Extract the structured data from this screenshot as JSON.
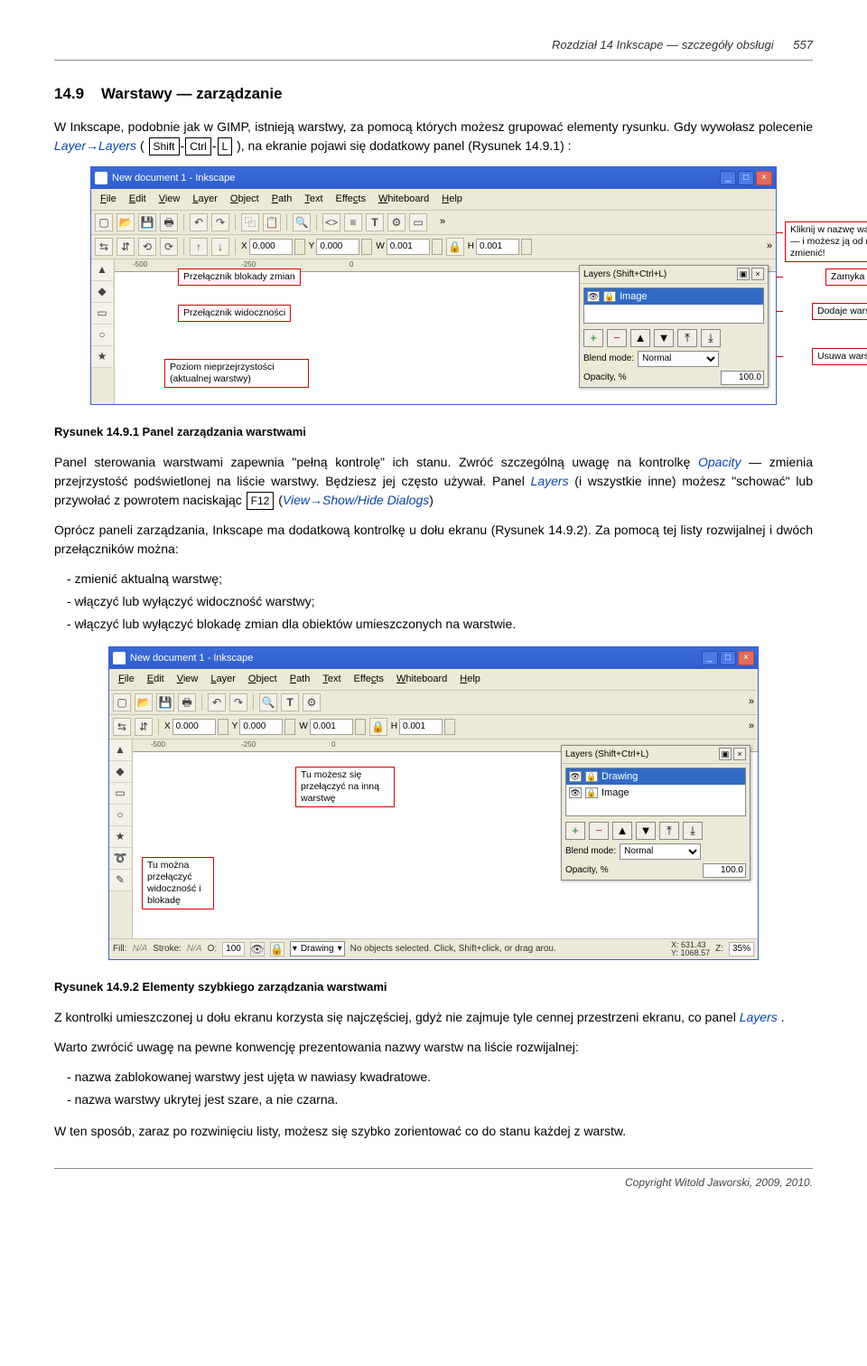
{
  "header": {
    "chapter": "Rozdział 14 Inkscape — szczegóły obsługi",
    "page": "557"
  },
  "section": {
    "num": "14.9",
    "title": "Warstawy — zarządzanie"
  },
  "para1_a": "W Inkscape, podobnie jak w GIMP, istnieją warstwy, za pomocą których możesz grupować elementy rysunku. Gdy wywołasz polecenie ",
  "para1_layer": "Layer→Layers",
  "para1_b": " ( ",
  "key_shift": "Shift",
  "key_ctrl": "Ctrl",
  "key_l": "L",
  "para1_c": " ), na ekranie pojawi się dodatkowy panel (Rysunek 14.9.1) :",
  "ss1": {
    "title": "New document 1 - Inkscape",
    "menus": [
      "File",
      "Edit",
      "View",
      "Layer",
      "Object",
      "Path",
      "Text",
      "Effects",
      "Whiteboard",
      "Help"
    ],
    "coords": {
      "x_label": "X",
      "x": "0.000",
      "y_label": "Y",
      "y": "0.000",
      "w_label": "W",
      "w": "0.001",
      "h_label": "H",
      "h": "0.001"
    },
    "ruler": {
      "m500": "-500",
      "m250": "-250",
      "zero": "0"
    },
    "panel": {
      "title": "Layers (Shift+Ctrl+L)",
      "layer_name": "Image",
      "blend_label": "Blend mode:",
      "blend_value": "Normal",
      "opacity_label": "Opacity, %",
      "opacity_value": "100.0"
    },
    "callouts": {
      "lock": "Przełącznik blokady zmian",
      "vis": "Przełącznik widoczności",
      "click": "Kliknij w nazwę warstwy — i możesz ją od razu zmienić!",
      "close": "Zamyka panel",
      "add": "Dodaje warstwę",
      "level": "Poziom nieprzejrzystości (aktualnej warstwy)",
      "remove": "Usuwa warstwę"
    }
  },
  "caption1": "Rysunek 14.9.1 Panel zarządzania warstwami",
  "para2_a": "Panel sterowania warstwami zapewnia \"pełną kontrolę\" ich stanu. Zwróć szczególną uwagę na kontrolkę ",
  "para2_opacity": "Opacity",
  "para2_b": " — zmienia przejrzystość podświetlonej na liście warstwy. Będziesz jej często używał. Panel ",
  "para2_layers": "Layers",
  "para2_c": " (i wszystkie inne) możesz \"schować\" lub przywołać z powrotem naciskając ",
  "key_f12": "F12",
  "para2_d": " (",
  "para2_view": "View→Show/Hide Dialogs",
  "para2_e": ")",
  "para3": "Oprócz paneli zarządzania, Inkscape ma dodatkową kontrolkę u dołu ekranu (Rysunek 14.9.2). Za pomocą tej listy rozwijalnej i dwóch przełączników można:",
  "list1": [
    "zmienić aktualną warstwę;",
    "włączyć lub wyłączyć widoczność warstwy;",
    "włączyć lub wyłączyć blokadę zmian dla obiektów umieszczonych na warstwie."
  ],
  "ss2": {
    "title": "New document 1 - Inkscape",
    "panel": {
      "layer1": "Drawing",
      "layer2": "Image",
      "blend_label": "Blend mode:",
      "blend_value": "Normal",
      "opacity_label": "Opacity, %",
      "opacity_value": "100.0"
    },
    "callouts": {
      "switch_layer": "Tu możesz się przełączyć na inną warstwę",
      "toggle": "Tu można przełączyć widoczność i blokadę"
    },
    "status": {
      "fill": "Fill:",
      "fill_val": "N/A",
      "stroke": "Stroke:",
      "stroke_val": "N/A",
      "o_label": "O:",
      "o_val": "100",
      "layer_dd": "Drawing",
      "msg": "No objects selected. Click, Shift+click, or drag arou.",
      "xy": "X: 631.43\nY: 1068.57",
      "z_label": "Z:",
      "z_val": "35%"
    }
  },
  "caption2": "Rysunek 14.9.2 Elementy szybkiego zarządzania warstwami",
  "para4_a": "Z kontrolki umieszczonej u dołu ekranu korzysta się najczęściej, gdyż nie zajmuje tyle cennej przestrzeni ekranu, co panel ",
  "para4_layers": "Layers",
  "para4_b": ".",
  "para5": "Warto zwrócić uwagę na pewne konwencję prezentowania nazwy warstw na liście rozwijalnej:",
  "list2": [
    "nazwa zablokowanej warstwy jest ujęta w nawiasy kwadratowe.",
    "nazwa warstwy ukrytej jest szare, a nie czarna."
  ],
  "para6": "W ten sposób, zaraz po rozwinięciu listy, możesz się szybko zorientować co do stanu każdej z warstw.",
  "footer": "Copyright Witold Jaworski, 2009, 2010."
}
